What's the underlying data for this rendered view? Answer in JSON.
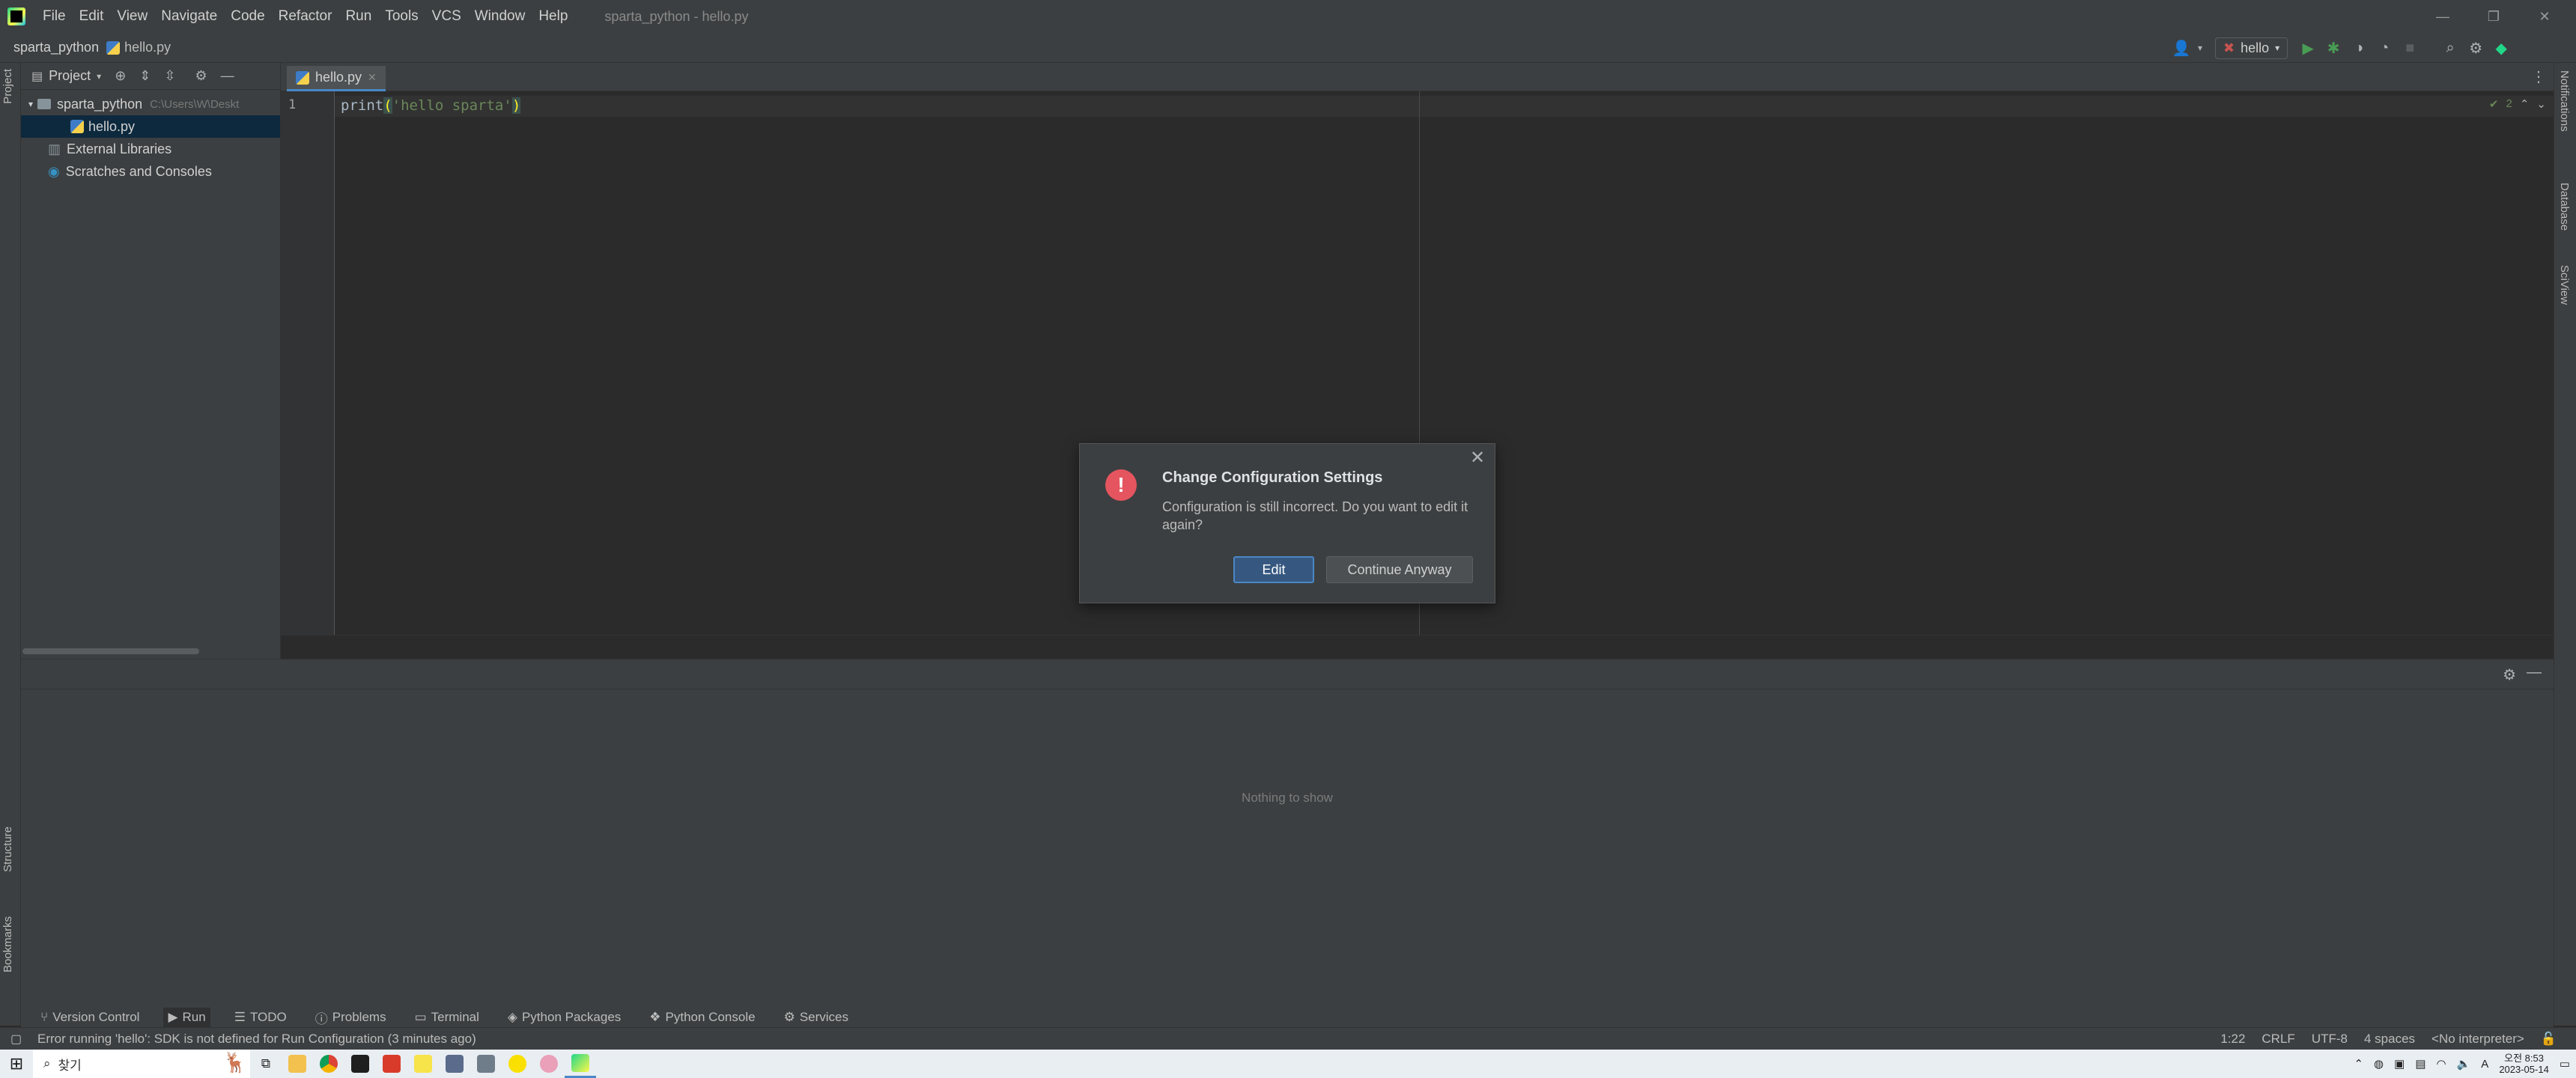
{
  "menu": [
    "File",
    "Edit",
    "View",
    "Navigate",
    "Code",
    "Refactor",
    "Run",
    "Tools",
    "VCS",
    "Window",
    "Help"
  ],
  "window_title": "sparta_python - hello.py",
  "breadcrumb": {
    "project": "sparta_python",
    "file": "hello.py"
  },
  "run_config": {
    "name": "hello"
  },
  "left_strip": {
    "project": "Project",
    "structure": "Structure",
    "bookmarks": "Bookmarks"
  },
  "right_strip": {
    "notifications": "Notifications",
    "database": "Database",
    "sciview": "SciView"
  },
  "project_panel": {
    "title": "Project",
    "tree": [
      {
        "label": "sparta_python",
        "path": "C:\\Users\\W\\Deskt",
        "type": "folder"
      },
      {
        "label": "hello.py",
        "type": "file",
        "selected": true
      },
      {
        "label": "External Libraries",
        "type": "lib"
      },
      {
        "label": "Scratches and Consoles",
        "type": "scratch"
      }
    ]
  },
  "editor": {
    "tab": "hello.py",
    "line_number": "1",
    "code_fn": "print",
    "code_open": "(",
    "code_str": "'hello sparta'",
    "code_close": ")",
    "inspection_count": "2"
  },
  "run_panel": {
    "empty_text": "Nothing to show"
  },
  "tool_windows": [
    "Version Control",
    "Run",
    "TODO",
    "Problems",
    "Terminal",
    "Python Packages",
    "Python Console",
    "Services"
  ],
  "status": {
    "message": "Error running 'hello': SDK is not defined for Run Configuration (3 minutes ago)",
    "position": "1:22",
    "line_sep": "CRLF",
    "encoding": "UTF-8",
    "indent": "4 spaces",
    "interpreter": "<No interpreter>"
  },
  "taskbar": {
    "search_placeholder": "찾기",
    "ime": "A",
    "clock_time": "오전 8:53",
    "clock_date": "2023-05-14"
  },
  "dialog": {
    "title": "Change Configuration Settings",
    "message": "Configuration is still incorrect. Do you want to edit it again?",
    "edit_label": "Edit",
    "continue_label": "Continue Anyway"
  },
  "colors": {
    "accent": "#4a88c7",
    "error": "#e5555f",
    "run_green": "#499c54"
  }
}
